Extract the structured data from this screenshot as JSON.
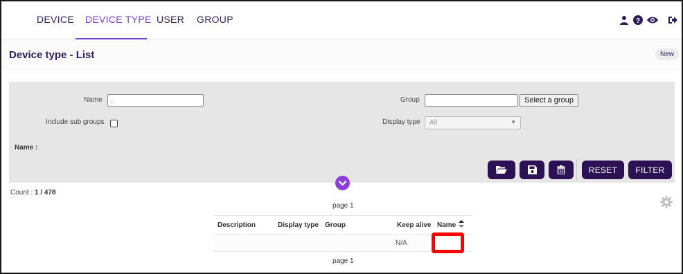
{
  "nav": {
    "tabs": [
      {
        "label": "DEVICE",
        "active": false
      },
      {
        "label": "DEVICE TYPE",
        "active": true
      },
      {
        "label": "USER",
        "active": false
      },
      {
        "label": "GROUP",
        "active": false
      }
    ],
    "icons": [
      "user-icon",
      "help-icon",
      "eye-icon",
      "logout-icon"
    ],
    "accent_color": "#7b3fd6",
    "text_color": "#2d1f5e"
  },
  "header": {
    "title": "Device type - List",
    "new_label": "New"
  },
  "filter": {
    "name_label": "Name",
    "name_value": ".",
    "group_label": "Group",
    "group_value": "",
    "select_group_label": "Select a group",
    "include_sub_groups_label": "Include sub groups",
    "include_sub_groups_checked": false,
    "display_type_label": "Display type",
    "display_type_value": "All",
    "name_summary": "Name :",
    "buttons": {
      "open_icon": "folder-open-icon",
      "save_icon": "save-icon",
      "delete_icon": "trash-icon",
      "reset_label": "RESET",
      "filter_label": "FILTER"
    },
    "button_color": "#2d1155",
    "expand_icon": "chevron-down-icon"
  },
  "list": {
    "count_label": "Count :",
    "count_value": "1 / 478",
    "pager_top": "page 1",
    "pager_bottom": "page 1",
    "settings_icon": "gear-icon",
    "columns": [
      "Description",
      "Display type",
      "Group",
      "Keep alive",
      "Name"
    ],
    "sorted_column": "Name",
    "rows": [
      {
        "description": "",
        "display_type": "",
        "group": "",
        "keep_alive": "N/A",
        "name": ""
      }
    ],
    "highlight_color": "#ff0000"
  }
}
